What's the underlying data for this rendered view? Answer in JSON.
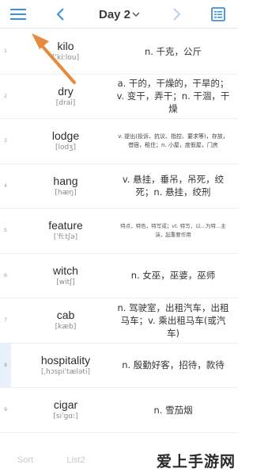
{
  "header": {
    "title": "Day 2",
    "icons": {
      "menu": "menu-icon",
      "prev": "chevron-left-icon",
      "title_dropdown": "chevron-down-icon",
      "next": "chevron-right-icon",
      "list": "list-icon"
    },
    "accent_color": "#3d8fe0"
  },
  "words": [
    {
      "num": "1",
      "word": "kilo",
      "phonetic": "[ˈkiːlou]",
      "definition": "n. 千克，公斤"
    },
    {
      "num": "2",
      "word": "dry",
      "phonetic": "[drai]",
      "definition": "a. 干的，干燥的，干旱的；v. 变干，弄干；n. 干涸，干燥"
    },
    {
      "num": "3",
      "word": "lodge",
      "phonetic": "[lodʒ]",
      "definition": "v. 提出(投诉、抗议、指控、要求等)，存放，借宿，租住；n. 小屋，度假屋，门房"
    },
    {
      "num": "4",
      "word": "hang",
      "phonetic": "[hæŋ]",
      "definition": "v. 悬挂，垂吊，吊死，绞死；n. 悬挂，绞刑"
    },
    {
      "num": "5",
      "word": "feature",
      "phonetic": "[ˈfiːtʃə]",
      "definition": "特点，特色，特写或；vt. 特写，以...为特...主演，起重要作用"
    },
    {
      "num": "6",
      "word": "witch",
      "phonetic": "[witʃ]",
      "definition": "n. 女巫，巫婆，巫师"
    },
    {
      "num": "7",
      "word": "cab",
      "phonetic": "[kæb]",
      "definition": "n. 驾驶室，出租汽车，出租马车；v. 乘出租马车(或汽车)"
    },
    {
      "num": "8",
      "word": "hospitality",
      "phonetic": "[ˌhɔspiˈtæləti]",
      "definition": "n. 殷勤好客，招待，款待"
    },
    {
      "num": "9",
      "word": "cigar",
      "phonetic": "[siˈgɑː]",
      "definition": "n. 雪茄烟"
    }
  ],
  "bottom": {
    "sort_label": "Sort",
    "list2_label": "List2"
  },
  "watermark": "爱上手游网",
  "arrow_color": "#e88a3c"
}
